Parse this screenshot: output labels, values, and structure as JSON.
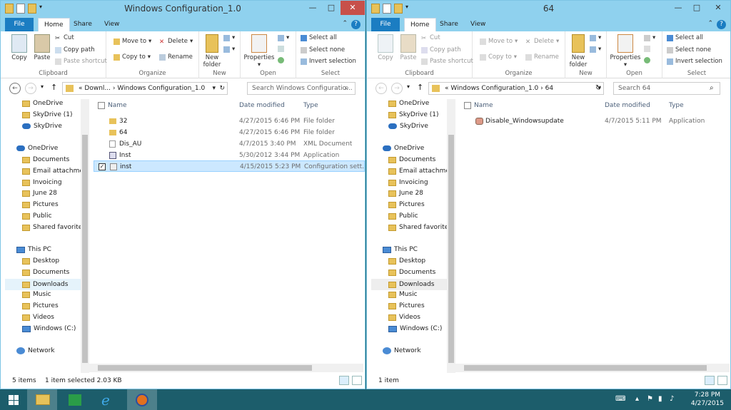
{
  "windows": [
    {
      "title": "Windows Configuration_1.0",
      "menu": {
        "file": "File",
        "home": "Home",
        "share": "Share",
        "view": "View"
      },
      "ribbon": {
        "clipboard": {
          "label": "Clipboard",
          "copy": "Copy",
          "paste": "Paste",
          "cut": "Cut",
          "copy_path": "Copy path",
          "paste_shortcut": "Paste shortcut"
        },
        "organize": {
          "label": "Organize",
          "move_to": "Move to",
          "copy_to": "Copy to",
          "delete": "Delete",
          "rename": "Rename"
        },
        "new": {
          "label": "New",
          "new_folder": "New folder"
        },
        "open": {
          "label": "Open",
          "properties": "Properties"
        },
        "select": {
          "label": "Select",
          "select_all": "Select all",
          "select_none": "Select none",
          "invert": "Invert selection"
        }
      },
      "address": {
        "path_prefix": "«",
        "crumb1": "Downl...",
        "crumb2": "Windows Configuration_1.0",
        "search_placeholder": "Search Windows Configuratio..."
      },
      "nav": [
        "OneDrive",
        "SkyDrive (1)",
        "SkyDrive",
        "OneDrive",
        "Documents",
        "Email attachmen",
        "Invoicing",
        "June 28",
        "Pictures",
        "Public",
        "Shared favorites",
        "This PC",
        "Desktop",
        "Documents",
        "Downloads",
        "Music",
        "Pictures",
        "Videos",
        "Windows (C:)",
        "Network"
      ],
      "columns": {
        "name": "Name",
        "date": "Date modified",
        "type": "Type"
      },
      "files": [
        {
          "name": "32",
          "date": "4/27/2015 6:46 PM",
          "type": "File folder"
        },
        {
          "name": "64",
          "date": "4/27/2015 6:46 PM",
          "type": "File folder"
        },
        {
          "name": "Dis_AU",
          "date": "4/7/2015 3:40 PM",
          "type": "XML Document"
        },
        {
          "name": "Inst",
          "date": "5/30/2012 3:44 PM",
          "type": "Application"
        },
        {
          "name": "inst",
          "date": "4/15/2015 5:23 PM",
          "type": "Configuration sett..."
        }
      ],
      "status": {
        "items": "5 items",
        "selected": "1 item selected  2.03 KB"
      }
    },
    {
      "title": "64",
      "menu": {
        "file": "File",
        "home": "Home",
        "share": "Share",
        "view": "View"
      },
      "ribbon": {
        "clipboard": {
          "label": "Clipboard",
          "copy": "Copy",
          "paste": "Paste",
          "cut": "Cut",
          "copy_path": "Copy path",
          "paste_shortcut": "Paste shortcut"
        },
        "organize": {
          "label": "Organize",
          "move_to": "Move to",
          "copy_to": "Copy to",
          "delete": "Delete",
          "rename": "Rename"
        },
        "new": {
          "label": "New",
          "new_folder": "New folder"
        },
        "open": {
          "label": "Open",
          "properties": "Properties"
        },
        "select": {
          "label": "Select",
          "select_all": "Select all",
          "select_none": "Select none",
          "invert": "Invert selection"
        }
      },
      "address": {
        "path_prefix": "«",
        "crumb1": "Windows Configuration_1.0",
        "crumb2": "64",
        "search_placeholder": "Search 64"
      },
      "nav": [
        "OneDrive",
        "SkyDrive (1)",
        "SkyDrive",
        "OneDrive",
        "Documents",
        "Email attachmen",
        "Invoicing",
        "June 28",
        "Pictures",
        "Public",
        "Shared favorites",
        "This PC",
        "Desktop",
        "Documents",
        "Downloads",
        "Music",
        "Pictures",
        "Videos",
        "Windows (C:)",
        "Network"
      ],
      "columns": {
        "name": "Name",
        "date": "Date modified",
        "type": "Type"
      },
      "files": [
        {
          "name": "Disable_Windowsupdate",
          "date": "4/7/2015 5:11 PM",
          "type": "Application"
        }
      ],
      "status": {
        "items": "1 item",
        "selected": ""
      }
    }
  ],
  "taskbar": {
    "time": "7:28 PM",
    "date": "4/27/2015"
  },
  "colors": {
    "titlebar": "#8fd1ee",
    "file_tab": "#1b7dc2",
    "close": "#c7504a",
    "taskbar": "#1c5d6b",
    "selection": "#cce8ff"
  }
}
